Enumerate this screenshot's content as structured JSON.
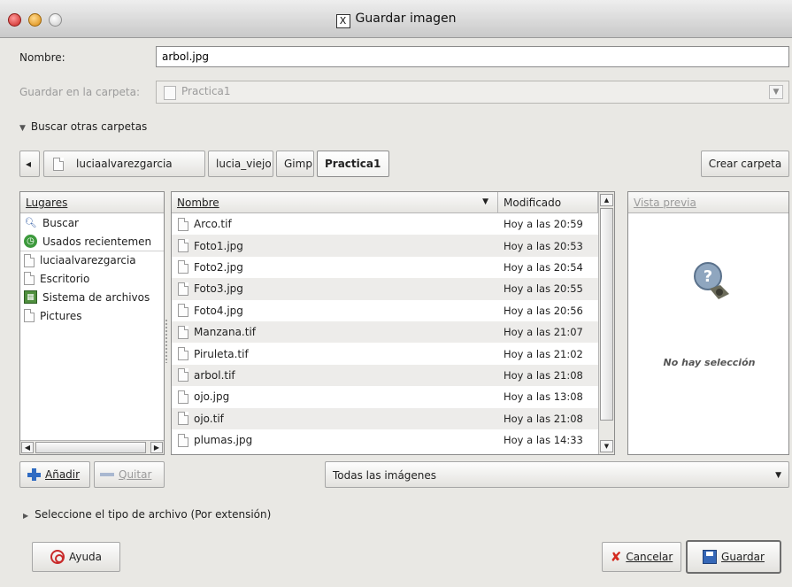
{
  "window": {
    "title": "Guardar imagen",
    "title_icon": "X"
  },
  "form": {
    "name_label": "Nombre:",
    "name_value": "arbol.jpg",
    "folder_label": "Guardar en la carpeta:",
    "folder_value": "Practica1",
    "browse_label": "Buscar otras carpetas"
  },
  "pathbar": {
    "back_label": "◂",
    "crumbs": [
      "luciaalvarezgarcia",
      "lucia_viejo",
      "Gimp",
      "Practica1"
    ],
    "create_folder_label": "Crear carpeta"
  },
  "places": {
    "header": "Lugares",
    "items": [
      {
        "label": "Buscar",
        "icon": "search-icon"
      },
      {
        "label": "Usados recientemen",
        "icon": "recent-icon"
      },
      {
        "label": "luciaalvarezgarcia",
        "icon": "home-folder-icon"
      },
      {
        "label": "Escritorio",
        "icon": "desktop-folder-icon"
      },
      {
        "label": "Sistema de archivos",
        "icon": "filesystem-icon"
      },
      {
        "label": "Pictures",
        "icon": "folder-icon"
      }
    ],
    "add_label": "Añadir",
    "remove_label": "Quitar"
  },
  "files": {
    "col_name": "Nombre",
    "col_modified": "Modificado",
    "rows": [
      {
        "name": "Arco.tif",
        "modified": "Hoy a las 20:59"
      },
      {
        "name": "Foto1.jpg",
        "modified": "Hoy a las 20:53"
      },
      {
        "name": "Foto2.jpg",
        "modified": "Hoy a las 20:54"
      },
      {
        "name": "Foto3.jpg",
        "modified": "Hoy a las 20:55"
      },
      {
        "name": "Foto4.jpg",
        "modified": "Hoy a las 20:56"
      },
      {
        "name": "Manzana.tif",
        "modified": "Hoy a las 21:07"
      },
      {
        "name": "Piruleta.tif",
        "modified": "Hoy a las 21:02"
      },
      {
        "name": "arbol.tif",
        "modified": "Hoy a las 21:08"
      },
      {
        "name": "ojo.jpg",
        "modified": "Hoy a las 13:08"
      },
      {
        "name": "ojo.tif",
        "modified": "Hoy a las 21:08"
      },
      {
        "name": "plumas.jpg",
        "modified": "Hoy a las 14:33"
      }
    ],
    "filter_value": "Todas las imágenes"
  },
  "preview": {
    "header": "Vista previa",
    "empty_text": "No hay selección",
    "icon_glyph": "?"
  },
  "filetype": {
    "expander_label": "Seleccione el tipo de archivo (Por extensión)"
  },
  "buttons": {
    "help": "Ayuda",
    "cancel": "Cancelar",
    "save": "Guardar"
  }
}
